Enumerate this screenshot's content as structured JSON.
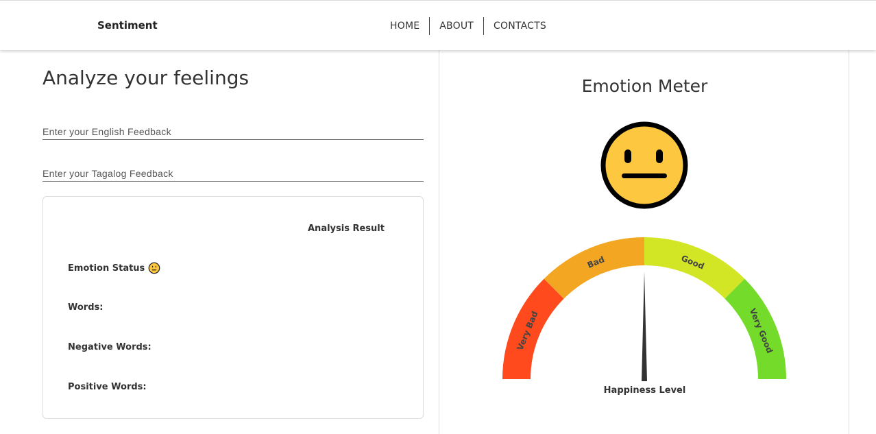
{
  "app": {
    "brand": "Sentiment"
  },
  "nav": {
    "items": [
      "HOME",
      "ABOUT",
      "CONTACTS"
    ]
  },
  "main": {
    "title": "Analyze your feelings",
    "english_placeholder": "Enter your English Feedback",
    "english_value": "",
    "tagalog_placeholder": "Enter your Tagalog Feedback",
    "tagalog_value": ""
  },
  "result": {
    "title": "Analysis Result",
    "emotion_label": "Emotion Status",
    "emotion_icon": "neutral-face-icon",
    "words_label": "Words:",
    "words_value": "",
    "negative_label": "Negative Words:",
    "negative_value": "",
    "positive_label": "Positive Words:",
    "positive_value": ""
  },
  "meter": {
    "title": "Emotion Meter",
    "face_icon": "neutral-face-icon",
    "face_color": "#fdc73f",
    "bands": [
      {
        "label": "Very Bad",
        "color": "#fe4a1c"
      },
      {
        "label": "Bad",
        "color": "#f2a622"
      },
      {
        "label": "Good",
        "color": "#d3e625"
      },
      {
        "label": "Very Good",
        "color": "#74db2a"
      }
    ],
    "level_fraction": 0.5,
    "gauge_label": "Happiness Level"
  }
}
